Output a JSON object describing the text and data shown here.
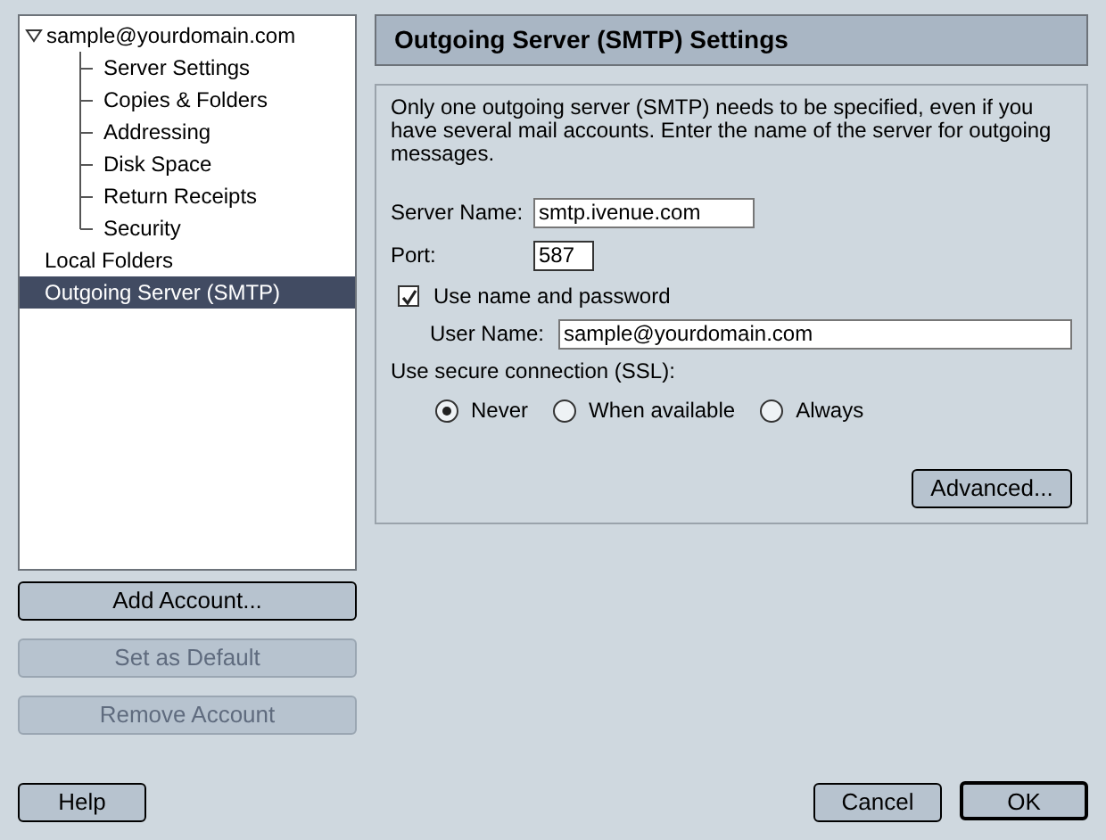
{
  "sidebar": {
    "items": [
      {
        "label": "sample@yourdomain.com",
        "expanded": true,
        "selected": false,
        "children": [
          {
            "label": "Server Settings",
            "selected": false
          },
          {
            "label": "Copies & Folders",
            "selected": false
          },
          {
            "label": "Addressing",
            "selected": false
          },
          {
            "label": "Disk Space",
            "selected": false
          },
          {
            "label": "Return Receipts",
            "selected": false
          },
          {
            "label": "Security",
            "selected": false
          }
        ]
      },
      {
        "label": "Local Folders",
        "selected": false
      },
      {
        "label": "Outgoing Server (SMTP)",
        "selected": true
      }
    ]
  },
  "account_buttons": [
    {
      "label": "Add Account...",
      "disabled": false
    },
    {
      "label": "Set as Default",
      "disabled": true
    },
    {
      "label": "Remove Account",
      "disabled": true
    }
  ],
  "panel": {
    "title": "Outgoing Server (SMTP) Settings",
    "description": "Only one outgoing server (SMTP) needs to be specified, even if you have several mail accounts. Enter the name of the server for outgoing messages.",
    "server_name": {
      "label": "Server Name:",
      "value": "smtp.ivenue.com"
    },
    "port": {
      "label": "Port:",
      "value": "587"
    },
    "use_name_password": {
      "label": "Use name and password",
      "checked": true
    },
    "user_name": {
      "label": "User Name:",
      "value": "sample@yourdomain.com"
    },
    "ssl": {
      "label": "Use secure connection (SSL):",
      "options": [
        {
          "label": "Never",
          "selected": true
        },
        {
          "label": "When available",
          "selected": false
        },
        {
          "label": "Always",
          "selected": false
        }
      ]
    },
    "advanced_button": "Advanced..."
  },
  "footer_buttons": [
    {
      "label": "Help",
      "default": false
    },
    {
      "label": "Cancel",
      "default": false
    },
    {
      "label": "OK",
      "default": true
    }
  ]
}
